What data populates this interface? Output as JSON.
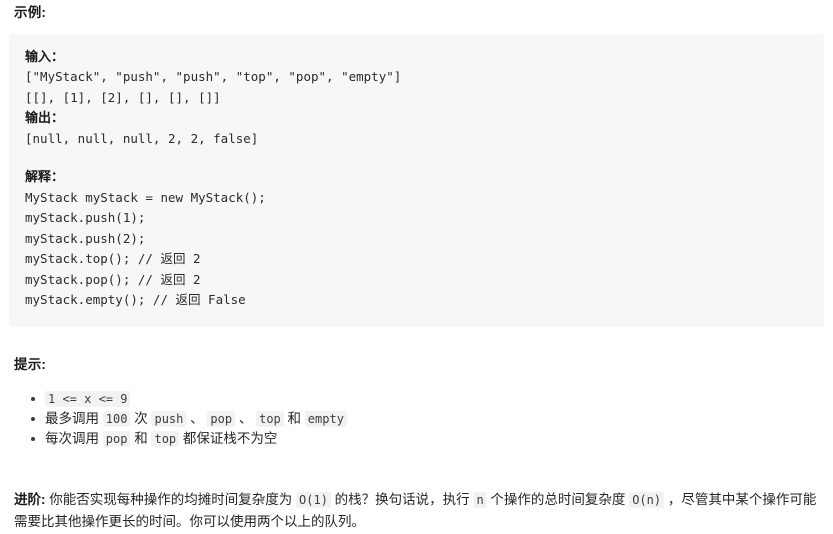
{
  "examples": {
    "heading": "示例:",
    "input_label": "输入：",
    "input_line1": "[\"MyStack\", \"push\", \"push\", \"top\", \"pop\", \"empty\"]",
    "input_line2": "[[], [1], [2], [], [], []]",
    "output_label": "输出：",
    "output_line": "[null, null, null, 2, 2, false]",
    "explain_label": "解释：",
    "explain_lines": [
      "MyStack myStack = new MyStack();",
      "myStack.push(1);",
      "myStack.push(2);",
      "myStack.top(); // 返回 2",
      "myStack.pop(); // 返回 2",
      "myStack.empty(); // 返回 False"
    ]
  },
  "hints": {
    "heading": "提示:",
    "items": [
      {
        "parts": [
          {
            "type": "code",
            "text": "1 <= x <= 9"
          }
        ]
      },
      {
        "parts": [
          {
            "type": "text",
            "text": "最多调用 "
          },
          {
            "type": "code",
            "text": "100"
          },
          {
            "type": "text",
            "text": " 次 "
          },
          {
            "type": "code",
            "text": "push"
          },
          {
            "type": "text",
            "text": " 、 "
          },
          {
            "type": "code",
            "text": "pop"
          },
          {
            "type": "text",
            "text": " 、 "
          },
          {
            "type": "code",
            "text": "top"
          },
          {
            "type": "text",
            "text": " 和 "
          },
          {
            "type": "code",
            "text": "empty"
          }
        ]
      },
      {
        "parts": [
          {
            "type": "text",
            "text": "每次调用 "
          },
          {
            "type": "code",
            "text": "pop"
          },
          {
            "type": "text",
            "text": " 和 "
          },
          {
            "type": "code",
            "text": "top"
          },
          {
            "type": "text",
            "text": " 都保证栈不为空"
          }
        ]
      }
    ]
  },
  "advanced": {
    "label": "进阶:",
    "parts": [
      {
        "type": "text",
        "text": " 你能否实现每种操作的均摊时间复杂度为 "
      },
      {
        "type": "code",
        "text": "O(1)"
      },
      {
        "type": "text",
        "text": " 的栈？换句话说，执行 "
      },
      {
        "type": "code",
        "text": "n"
      },
      {
        "type": "text",
        "text": " 个操作的总时间复杂度 "
      },
      {
        "type": "code",
        "text": "O(n)"
      },
      {
        "type": "text",
        "text": " ，尽管其中某个操作可能需要比其他操作更长的时间。你可以使用两个以上的队列。"
      }
    ]
  },
  "colors": {
    "page_background": "#ffffff",
    "code_block_background": "#f7f7f7",
    "inline_code_background": "#f2f2f2",
    "body_text": "#262626",
    "heading_text": "#1a1a1a"
  }
}
